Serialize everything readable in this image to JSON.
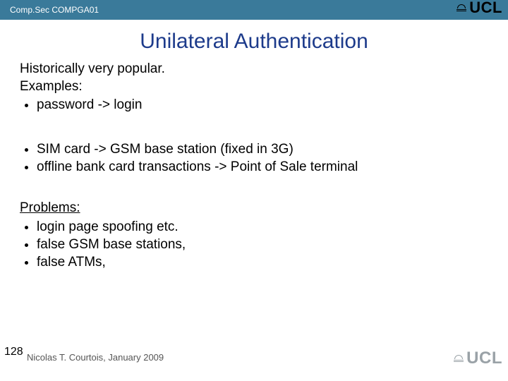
{
  "header": {
    "course": "Comp.Sec COMPGA01"
  },
  "title": "Unilateral Authentication",
  "intro": {
    "line1": "Historically very popular.",
    "line2": "Examples:"
  },
  "examples1": [
    "password -> login"
  ],
  "examples2": [
    "SIM card -> GSM base station (fixed in 3G)",
    "offline bank card transactions -> Point of Sale terminal"
  ],
  "problems_heading": "Problems:",
  "problems": [
    "login page spoofing etc.",
    "false GSM base stations,",
    "false ATMs,"
  ],
  "footer": {
    "page": "128",
    "author": "Nicolas T. Courtois, January 2009"
  },
  "logo_text": "UCL"
}
